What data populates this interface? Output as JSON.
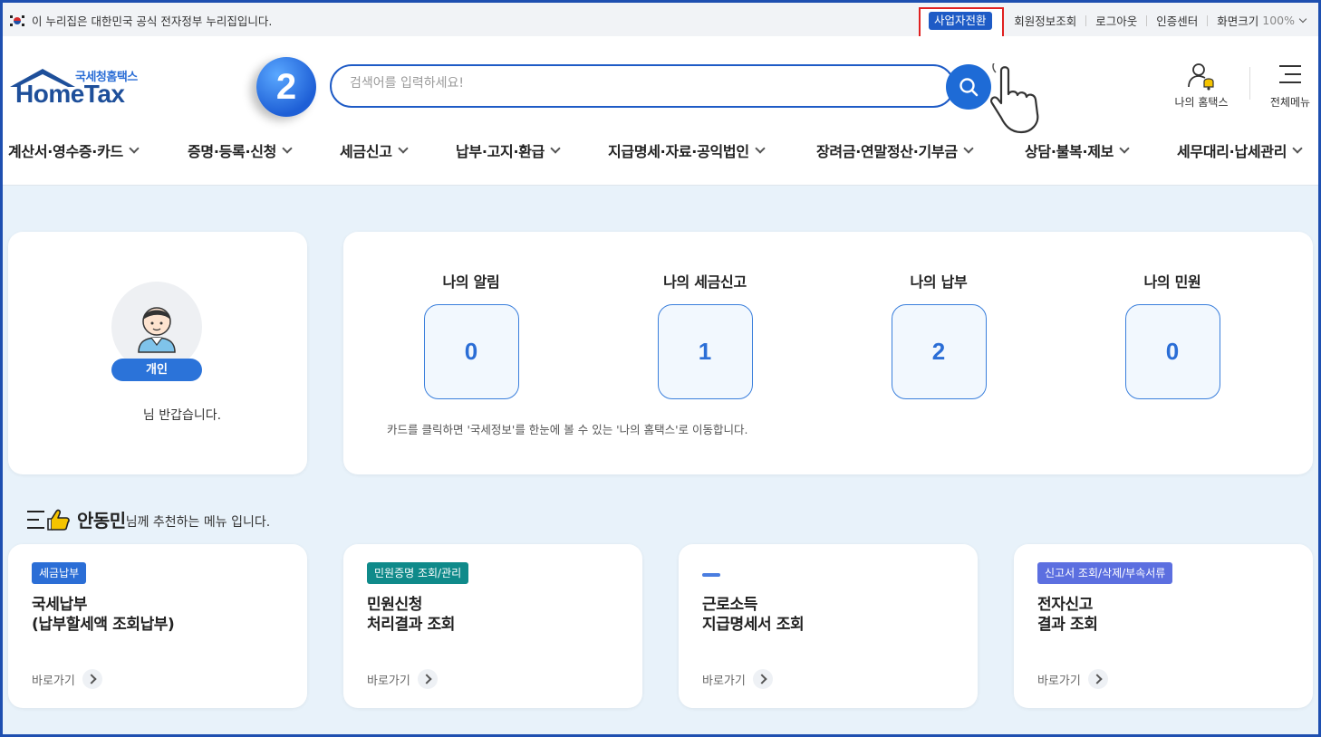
{
  "govbar": {
    "notice": "이 누리집은 대한민국 공식 전자정부 누리집입니다.",
    "switch_label": "사업자전환",
    "links": [
      "회원정보조회",
      "로그아웃",
      "인증센터"
    ],
    "zoom_label": "화면크기",
    "zoom_value": "100%"
  },
  "header": {
    "logo_sub": "국세청홈택스",
    "logo_main": "HomeTax",
    "step_badge": "2",
    "search_placeholder": "검색어를 입력하세요!",
    "my_hometax": "나의 홈택스",
    "all_menu": "전체메뉴"
  },
  "gnb": [
    "계산서·영수증·카드",
    "증명·등록·신청",
    "세금신고",
    "납부·고지·환급",
    "지급명세·자료·공익법인",
    "장려금·연말정산·기부금",
    "상담·불복·제보",
    "세무대리·납세관리"
  ],
  "profile": {
    "type": "개인",
    "greeting": "님 반갑습니다."
  },
  "summary": {
    "stats": [
      {
        "label": "나의 알림",
        "value": "0"
      },
      {
        "label": "나의 세금신고",
        "value": "1"
      },
      {
        "label": "나의 납부",
        "value": "2"
      },
      {
        "label": "나의 민원",
        "value": "0"
      }
    ],
    "note": "카드를 클릭하면 '국세정보'를 한눈에 볼 수 있는 '나의 홈택스'로 이동합니다."
  },
  "recommend": {
    "user": "안동민",
    "suffix": "님께 추천하는 메뉴 입니다.",
    "go_label": "바로가기",
    "cards": [
      {
        "tag": "세금납부",
        "tag_color": "#2b6ed6",
        "line1": "국세납부",
        "line2": "(납부할세액 조회납부)"
      },
      {
        "tag": "민원증명 조회/관리",
        "tag_color": "#0f8a8a",
        "line1": "민원신청",
        "line2": "처리결과 조회"
      },
      {
        "tag": "",
        "tag_color": "#4a7de0",
        "line1": "근로소득",
        "line2": "지급명세서 조회"
      },
      {
        "tag": "신고서 조회/삭제/부속서류",
        "tag_color": "#5c6fe0",
        "line1": "전자신고",
        "line2": "결과 조회"
      }
    ]
  },
  "colors": {
    "primary": "#1e5bc6",
    "highlight_box": "#e02020",
    "page_bg": "#e8f2fa"
  }
}
